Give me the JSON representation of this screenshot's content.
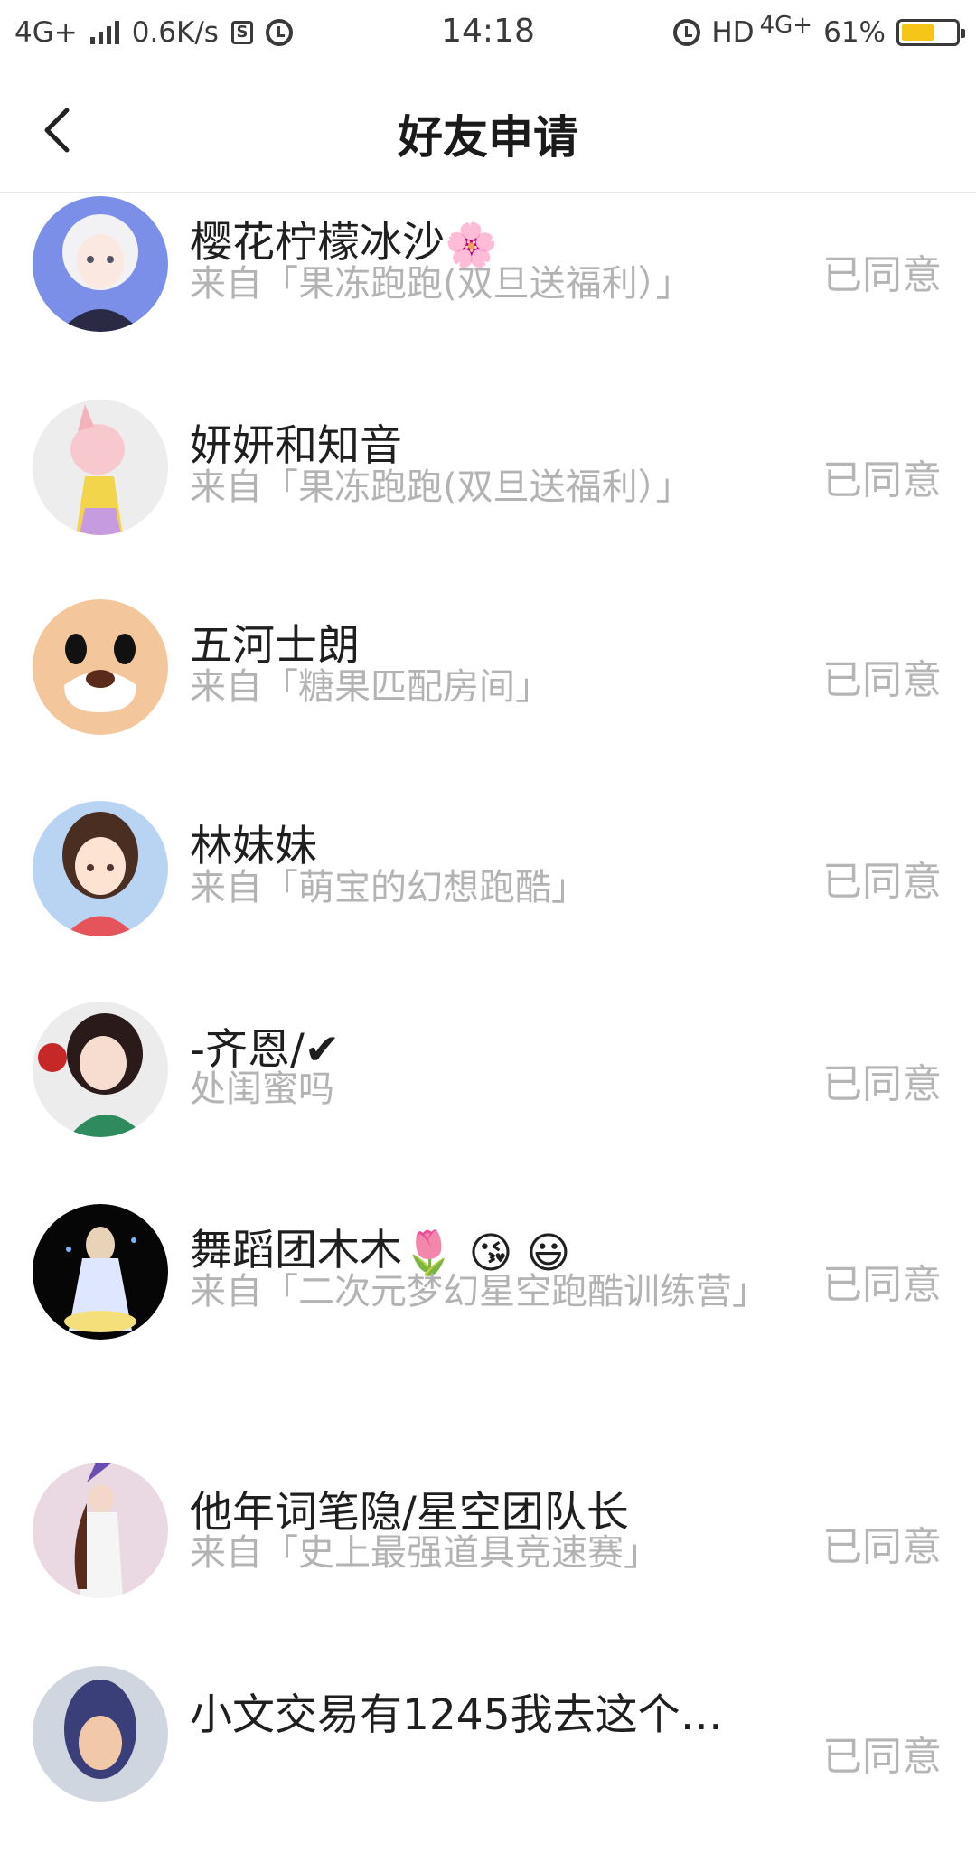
{
  "status_bar": {
    "network": "4G+",
    "speed": "0.6K/s",
    "time": "14:18",
    "hd": "HD",
    "network_right": "4G+",
    "battery_pct": "61%",
    "battery_level": 0.61,
    "battery_color": "#f5c518"
  },
  "header": {
    "title": "好友申请",
    "back_icon": "chevron-left-icon"
  },
  "requests": [
    {
      "name": "樱花柠檬冰沙",
      "name_emoji": "🌸",
      "source": "来自「果冻跑跑(双旦送福利）」",
      "status": "已同意"
    },
    {
      "name": "妍妍和知音",
      "name_emoji": "",
      "source": "来自「果冻跑跑(双旦送福利）」",
      "status": "已同意"
    },
    {
      "name": "五河士朗",
      "name_emoji": "",
      "source": "来自「糖果匹配房间」",
      "status": "已同意"
    },
    {
      "name": "林妹妹",
      "name_emoji": "",
      "source": "来自「萌宝的幻想跑酷」",
      "status": "已同意"
    },
    {
      "name": "-齐恩/✔",
      "name_emoji": "",
      "source": "处闺蜜吗",
      "status": "已同意"
    },
    {
      "name": "舞蹈团木木",
      "name_emoji": "🌷 😘 😃",
      "source": "来自「二次元梦幻星空跑酷训练营」",
      "status": "已同意"
    },
    {
      "name": "他年词笔隐/星空团队长",
      "name_emoji": "",
      "source": "来自「史上最强道具竞速赛」",
      "status": "已同意"
    },
    {
      "name": "小文交易有1245我去这个…",
      "name_emoji": "",
      "source": "",
      "status": "已同意"
    }
  ]
}
